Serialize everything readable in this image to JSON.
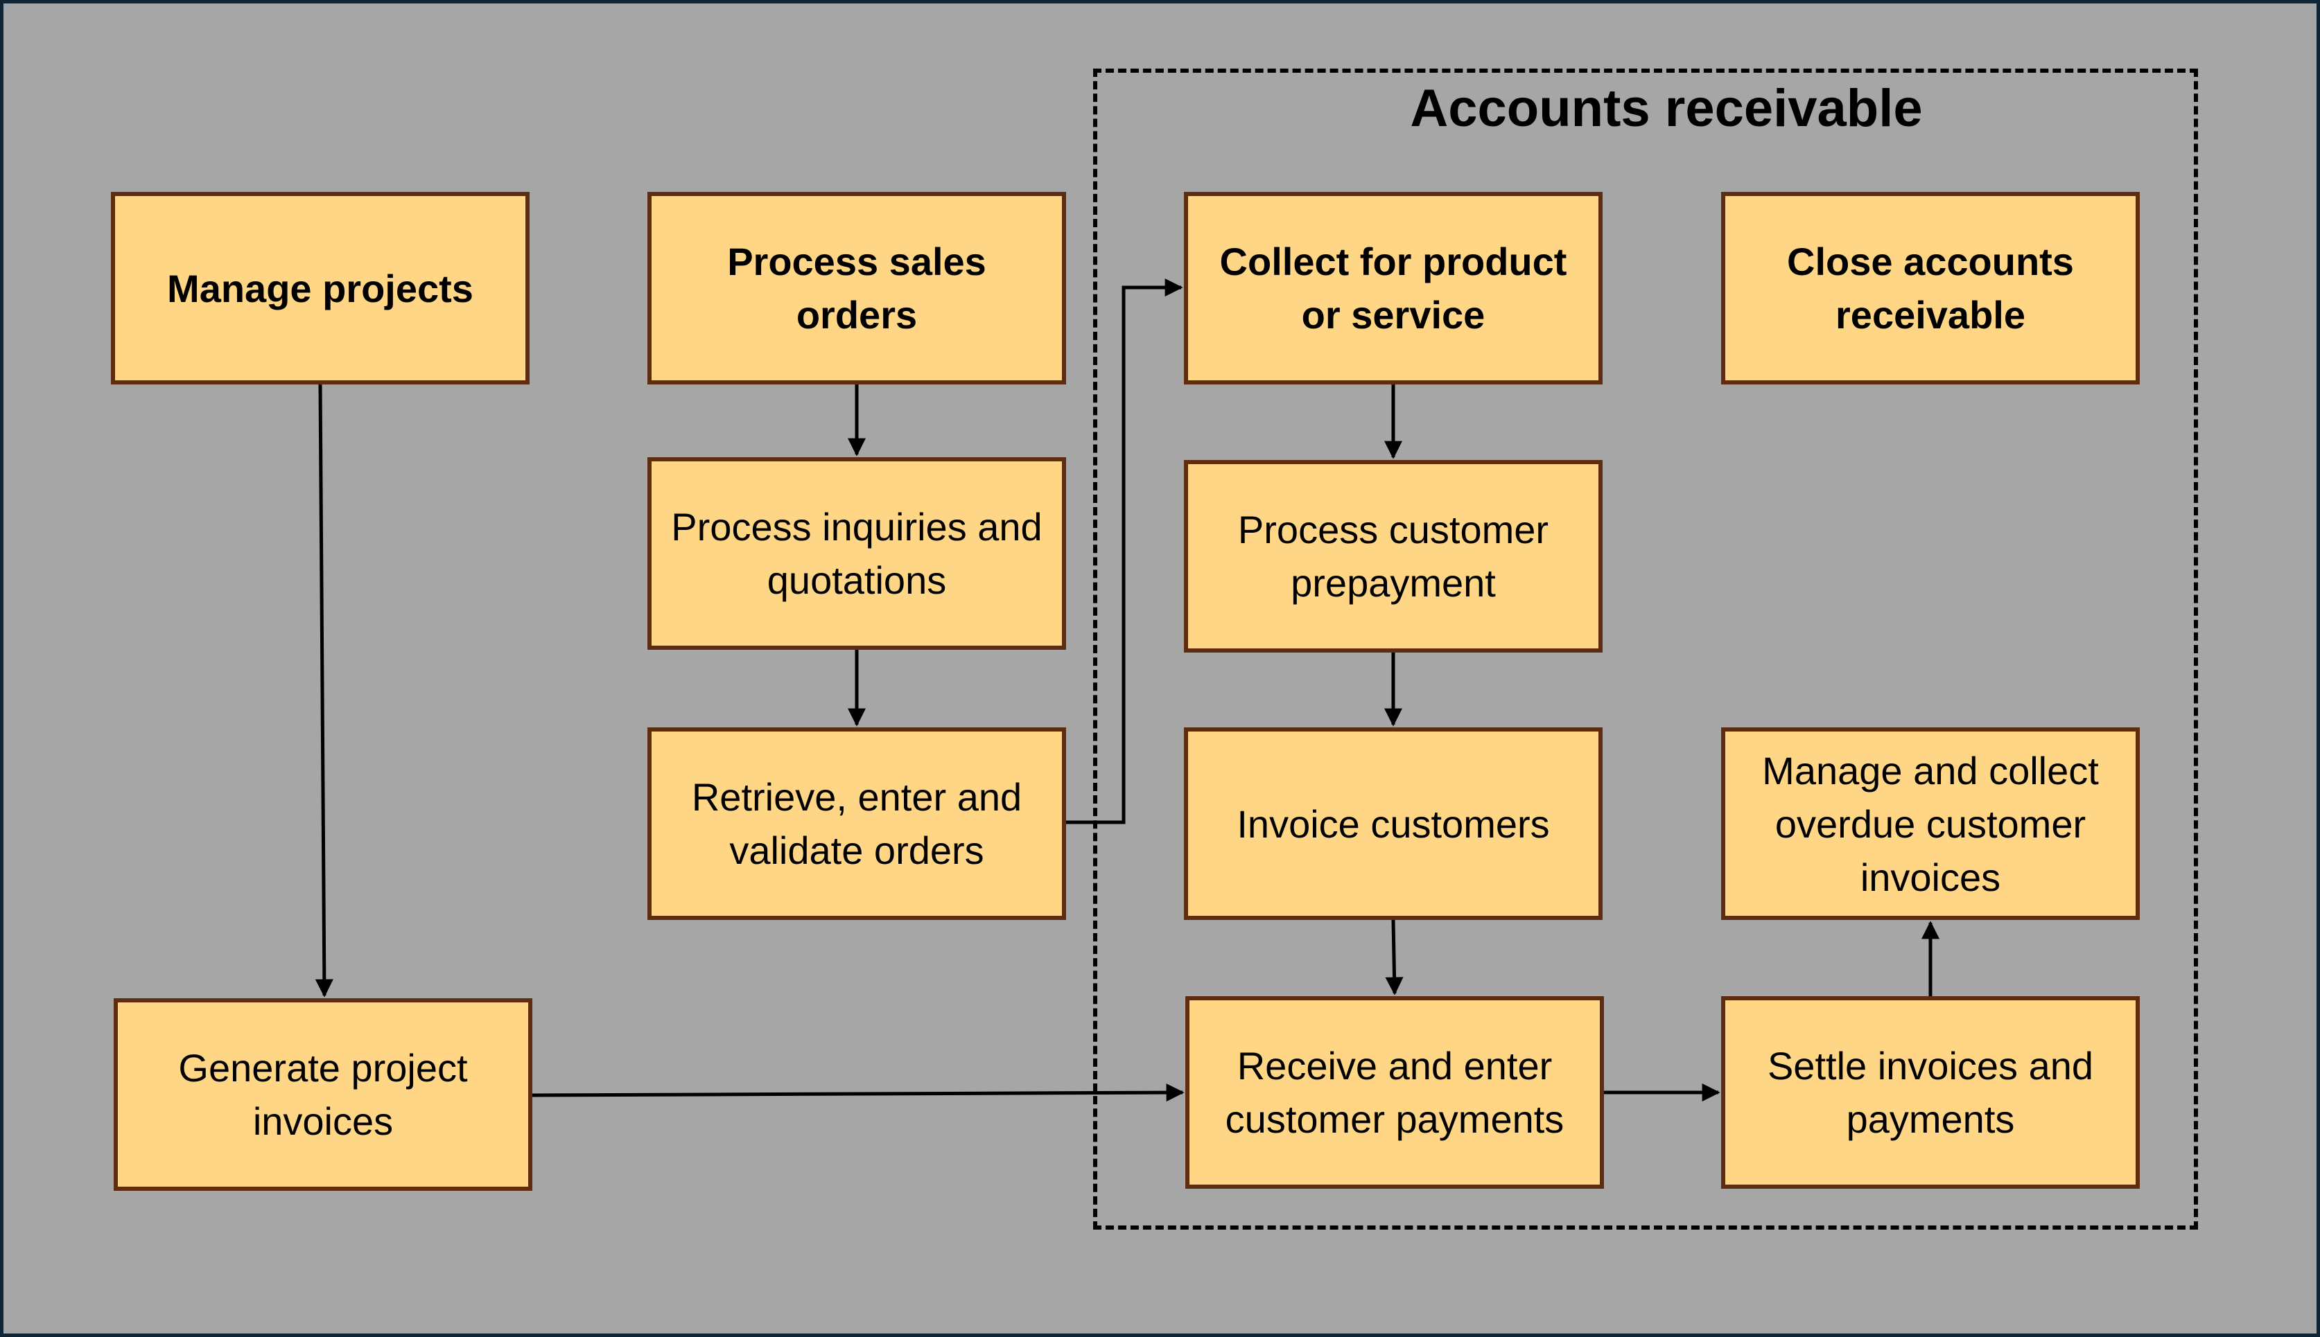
{
  "colors": {
    "background": "#a6a6a6",
    "frame": "#0f2535",
    "box_fill": "#ffd685",
    "box_border": "#5e2c0e",
    "arrow": "#000000"
  },
  "group": {
    "title": "Accounts receivable",
    "style": "dashed"
  },
  "nodes": [
    {
      "id": "manage-projects",
      "label": "Manage projects",
      "bold": true
    },
    {
      "id": "process-sales-orders",
      "label": "Process sales orders",
      "bold": true
    },
    {
      "id": "collect-product-service",
      "label": "Collect for product or service",
      "bold": true
    },
    {
      "id": "close-ar",
      "label": "Close accounts receivable",
      "bold": true
    },
    {
      "id": "inquiries-quotations",
      "label": "Process inquiries and quotations",
      "bold": false
    },
    {
      "id": "customer-prepayment",
      "label": "Process customer prepayment",
      "bold": false
    },
    {
      "id": "retrieve-validate-orders",
      "label": "Retrieve, enter and validate orders",
      "bold": false
    },
    {
      "id": "invoice-customers",
      "label": "Invoice customers",
      "bold": false
    },
    {
      "id": "manage-overdue",
      "label": "Manage and collect overdue customer invoices",
      "bold": false
    },
    {
      "id": "generate-project-invoices",
      "label": "Generate project invoices",
      "bold": false
    },
    {
      "id": "receive-payments",
      "label": "Receive and enter customer payments",
      "bold": false
    },
    {
      "id": "settle-invoices",
      "label": "Settle invoices and payments",
      "bold": false
    }
  ],
  "edges": [
    {
      "from": "manage-projects",
      "to": "generate-project-invoices"
    },
    {
      "from": "process-sales-orders",
      "to": "inquiries-quotations"
    },
    {
      "from": "inquiries-quotations",
      "to": "retrieve-validate-orders"
    },
    {
      "from": "retrieve-validate-orders",
      "to": "collect-product-service"
    },
    {
      "from": "collect-product-service",
      "to": "customer-prepayment"
    },
    {
      "from": "customer-prepayment",
      "to": "invoice-customers"
    },
    {
      "from": "invoice-customers",
      "to": "receive-payments"
    },
    {
      "from": "generate-project-invoices",
      "to": "receive-payments"
    },
    {
      "from": "receive-payments",
      "to": "settle-invoices"
    },
    {
      "from": "settle-invoices",
      "to": "manage-overdue"
    }
  ]
}
